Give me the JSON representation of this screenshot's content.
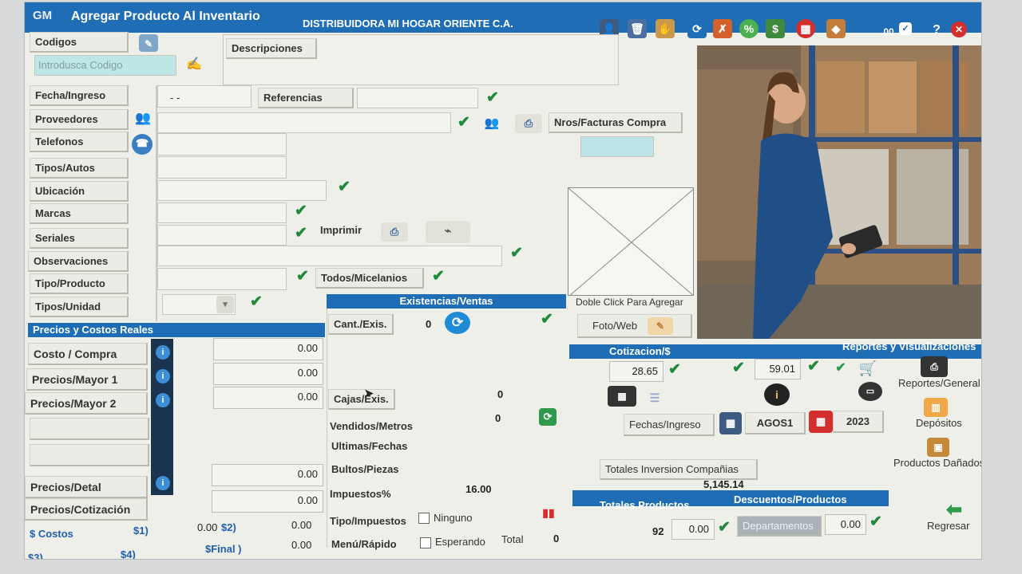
{
  "title_bar": {
    "logo": "GM",
    "title": "Agregar Producto Al Inventario",
    "company": "DISTRIBUIDORA MI HOGAR ORIENTE C.A.",
    "counter": ".00"
  },
  "header": {
    "codigos_label": "Codigos",
    "codigo_placeholder": "Introdusca Codigo",
    "descripciones_label": "Descripciones"
  },
  "form": {
    "fecha_ingreso_label": "Fecha/Ingreso",
    "fecha_ingreso_value": "- -",
    "referencias_label": "Referencias",
    "proveedores_label": "Proveedores",
    "nros_facturas_label": "Nros/Facturas Compra",
    "telefonos_label": "Telefonos",
    "tipos_autos_label": "Tipos/Autos",
    "ubicacion_label": "Ubicación",
    "marcas_label": "Marcas",
    "seriales_label": "Seriales",
    "imprimir_label": "Imprimir",
    "observaciones_label": "Observaciones",
    "tipo_producto_label": "Tipo/Producto",
    "todos_micelanios_label": "Todos/Micelanios",
    "tipos_unidad_label": "Tipos/Unidad"
  },
  "photo": {
    "doble_click_label": "Doble Click Para Agregar",
    "foto_web_label": "Foto/Web"
  },
  "precios": {
    "header": "Precios y Costos Reales",
    "rows": [
      {
        "label": "Costo / Compra",
        "value": "0.00"
      },
      {
        "label": "Precios/Mayor 1",
        "value": "0.00"
      },
      {
        "label": "Precios/Mayor 2",
        "value": "0.00"
      }
    ],
    "detal_label": "Precios/Detal",
    "detal_value": "0.00",
    "cotizacion_label": "Precios/Cotización",
    "cotizacion_value": "0.00",
    "costos_label": "$ Costos",
    "s1_label": "$1)",
    "s1_value": "0.00",
    "s2_label": "$2)",
    "s2_value": "0.00",
    "s3_label": "$3)",
    "s4_label": "$4)",
    "final_label": "$Final )",
    "final_value": "0.00",
    "info_glyph": "i"
  },
  "existencias": {
    "header": "Existencias/Ventas",
    "cant_exis_label": "Cant./Exis.",
    "cant_exis_value": "0",
    "cajas_exis_label": "Cajas/Exis.",
    "cajas_exis_value": "0",
    "vendidos_label": "Vendidos/Metros",
    "vendidos_value": "0",
    "ultimas_fechas_label": "Ultimas/Fechas",
    "bultos_label": "Bultos/Piezas",
    "impuestos_label": "Impuestos%",
    "impuestos_value": "16.00",
    "tipo_impuestos_label": "Tipo/Impuestos",
    "ninguno_label": "Ninguno",
    "menu_rapido_label": "Menú/Rápido",
    "esperando_label": "Esperando",
    "total_label": "Total",
    "total_value": "0"
  },
  "cotizacion": {
    "header": "Cotizacion/$",
    "reportes_header": "Reportes y Visualizaciones",
    "rate1": "28.65",
    "rate2": "59.01",
    "fechas_ingreso_label": "Fechas/Ingreso",
    "month": "AGOS1",
    "year": "2023",
    "totales_inversion_label": "Totales Inversion Compañias",
    "totales_inversion_value": "5,145.14",
    "totales_productos_label": "Totales Productos",
    "descuentos_label": "Descuentos/Productos",
    "productos_count": "92",
    "productos_value": "0.00",
    "departamentos_label": "Departamentos",
    "descuento_value": "0.00"
  },
  "sidebar_right": {
    "reportes_general": "Reportes/General",
    "depositos": "Depósitos",
    "productos_danados": "Productos Dañados",
    "regresar": "Regresar"
  },
  "colors": {
    "accent": "#1f6db5",
    "check": "#1f8a3a",
    "background": "#efefe9"
  }
}
